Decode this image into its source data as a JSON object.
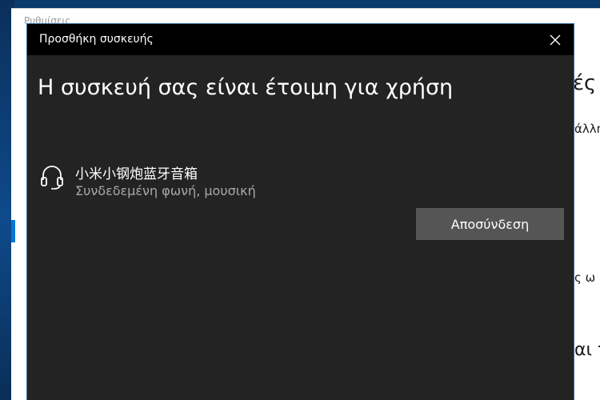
{
  "settings": {
    "title": "Ρυθμίσεις",
    "peek_texts": [
      "ές",
      "άλλη",
      "ς ω",
      "αι τ"
    ]
  },
  "dialog": {
    "title": "Προσθήκη συσκευής",
    "heading": "Η συσκευή σας είναι έτοιμη για χρήση",
    "device": {
      "icon": "headset-icon",
      "name": "小米小钢炮蓝牙音箱",
      "status": "Συνδεδεμένη φωνή, μουσική"
    },
    "disconnect_label": "Αποσύνδεση",
    "close_icon": "close-icon"
  },
  "colors": {
    "dialog_bg": "#232323",
    "titlebar_bg": "#000000",
    "button_bg": "#555555",
    "accent": "#0078d7",
    "border": "#3a6ea5"
  }
}
